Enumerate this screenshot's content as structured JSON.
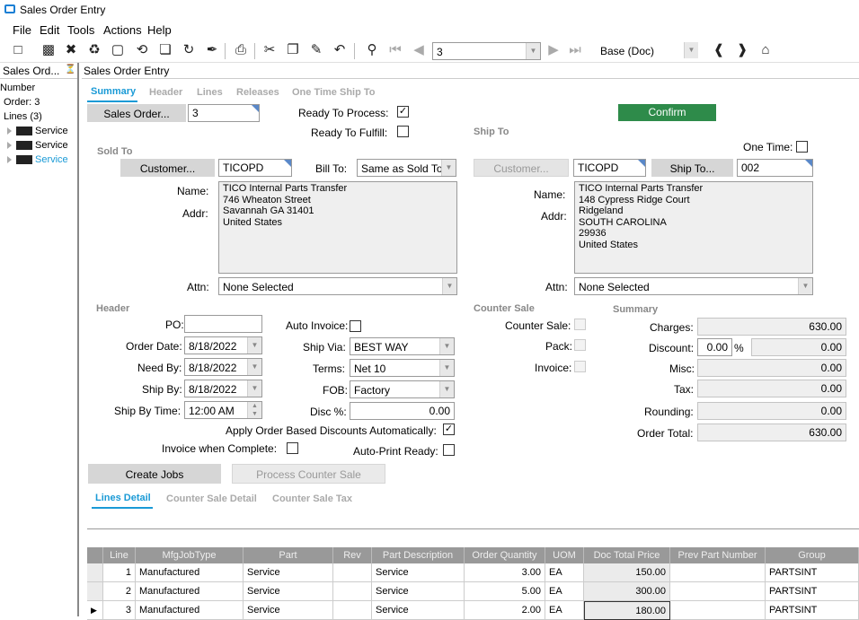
{
  "window": {
    "title": "Sales Order Entry"
  },
  "menu": [
    "File",
    "Edit",
    "Tools",
    "Actions",
    "Help"
  ],
  "toolbar": {
    "record_value": "3",
    "layer_value": "Base (Doc)"
  },
  "left_pane": {
    "title": "Sales Ord...",
    "items": [
      "Number",
      "Order: 3",
      "Lines (3)"
    ],
    "nodes": [
      "Service",
      "Service",
      "Service"
    ]
  },
  "main": {
    "title": "Sales Order Entry",
    "tabs": [
      "Summary",
      "Header",
      "Lines",
      "Releases",
      "One Time Ship To"
    ],
    "sales_order_button": "Sales Order...",
    "sales_order_value": "3",
    "ready_to_process_label": "Ready To Process:",
    "ready_to_fulfill_label": "Ready To Fulfill:",
    "confirm_button": "Confirm",
    "sold_to": {
      "section": "Sold To",
      "customer_button": "Customer...",
      "customer_value": "TICOPD",
      "bill_to_label": "Bill To:",
      "bill_to_value": "Same as Sold To",
      "name_label": "Name:",
      "addr_label": "Addr:",
      "address": "TICO Internal Parts Transfer\n746 Wheaton Street\nSavannah GA 31401\nUnited States",
      "attn_label": "Attn:",
      "attn_value": "None Selected"
    },
    "ship_to": {
      "section": "Ship To",
      "one_time_label": "One Time:",
      "customer_button": "Customer...",
      "customer_value": "TICOPD",
      "ship_to_button": "Ship To...",
      "ship_to_value": "002",
      "name_label": "Name:",
      "addr_label": "Addr:",
      "address": "TICO Internal Parts Transfer\n148 Cypress Ridge Court\nRidgeland\nSOUTH CAROLINA\n29936\nUnited States",
      "attn_label": "Attn:",
      "attn_value": "None Selected"
    },
    "header": {
      "section": "Header",
      "po_label": "PO:",
      "po_value": "",
      "order_date_label": "Order Date:",
      "order_date_value": "8/18/2022",
      "need_by_label": "Need By:",
      "need_by_value": "8/18/2022",
      "ship_by_label": "Ship By:",
      "ship_by_value": "8/18/2022",
      "ship_by_time_label": "Ship By Time:",
      "ship_by_time_value": "12:00 AM",
      "auto_invoice_label": "Auto Invoice:",
      "ship_via_label": "Ship Via:",
      "ship_via_value": "BEST WAY",
      "terms_label": "Terms:",
      "terms_value": "Net 10",
      "fob_label": "FOB:",
      "fob_value": "Factory",
      "disc_label": "Disc %:",
      "disc_value": "0.00",
      "apply_discounts_label": "Apply Order Based Discounts Automatically:",
      "invoice_complete_label": "Invoice when Complete:",
      "auto_print_label": "Auto-Print Ready:"
    },
    "counter_sale": {
      "section": "Counter Sale",
      "counter_sale_label": "Counter Sale:",
      "pack_label": "Pack:",
      "invoice_label": "Invoice:"
    },
    "summary": {
      "section": "Summary",
      "charges_label": "Charges:",
      "charges_value": "630.00",
      "discount_label": "Discount:",
      "discount_pct": "0.00",
      "pct_sign": "%",
      "discount_value": "0.00",
      "misc_label": "Misc:",
      "misc_value": "0.00",
      "tax_label": "Tax:",
      "tax_value": "0.00",
      "rounding_label": "Rounding:",
      "rounding_value": "0.00",
      "order_total_label": "Order Total:",
      "order_total_value": "630.00"
    },
    "create_jobs_button": "Create Jobs",
    "process_counter_sale_button": "Process Counter Sale",
    "detail_tabs": [
      "Lines Detail",
      "Counter Sale Detail",
      "Counter Sale Tax"
    ]
  },
  "grid": {
    "columns": [
      "Line",
      "MfgJobType",
      "Part",
      "Rev",
      "Part Description",
      "Order Quantity",
      "UOM",
      "Doc Total Price",
      "Prev Part Number",
      "Group"
    ],
    "rows": [
      [
        "1",
        "Manufactured",
        "Service",
        "",
        "Service",
        "3.00",
        "EA",
        "150.00",
        "",
        "PARTSINT"
      ],
      [
        "2",
        "Manufactured",
        "Service",
        "",
        "Service",
        "5.00",
        "EA",
        "300.00",
        "",
        "PARTSINT"
      ],
      [
        "3",
        "Manufactured",
        "Service",
        "",
        "Service",
        "2.00",
        "EA",
        "180.00",
        "",
        "PARTSINT"
      ]
    ]
  }
}
